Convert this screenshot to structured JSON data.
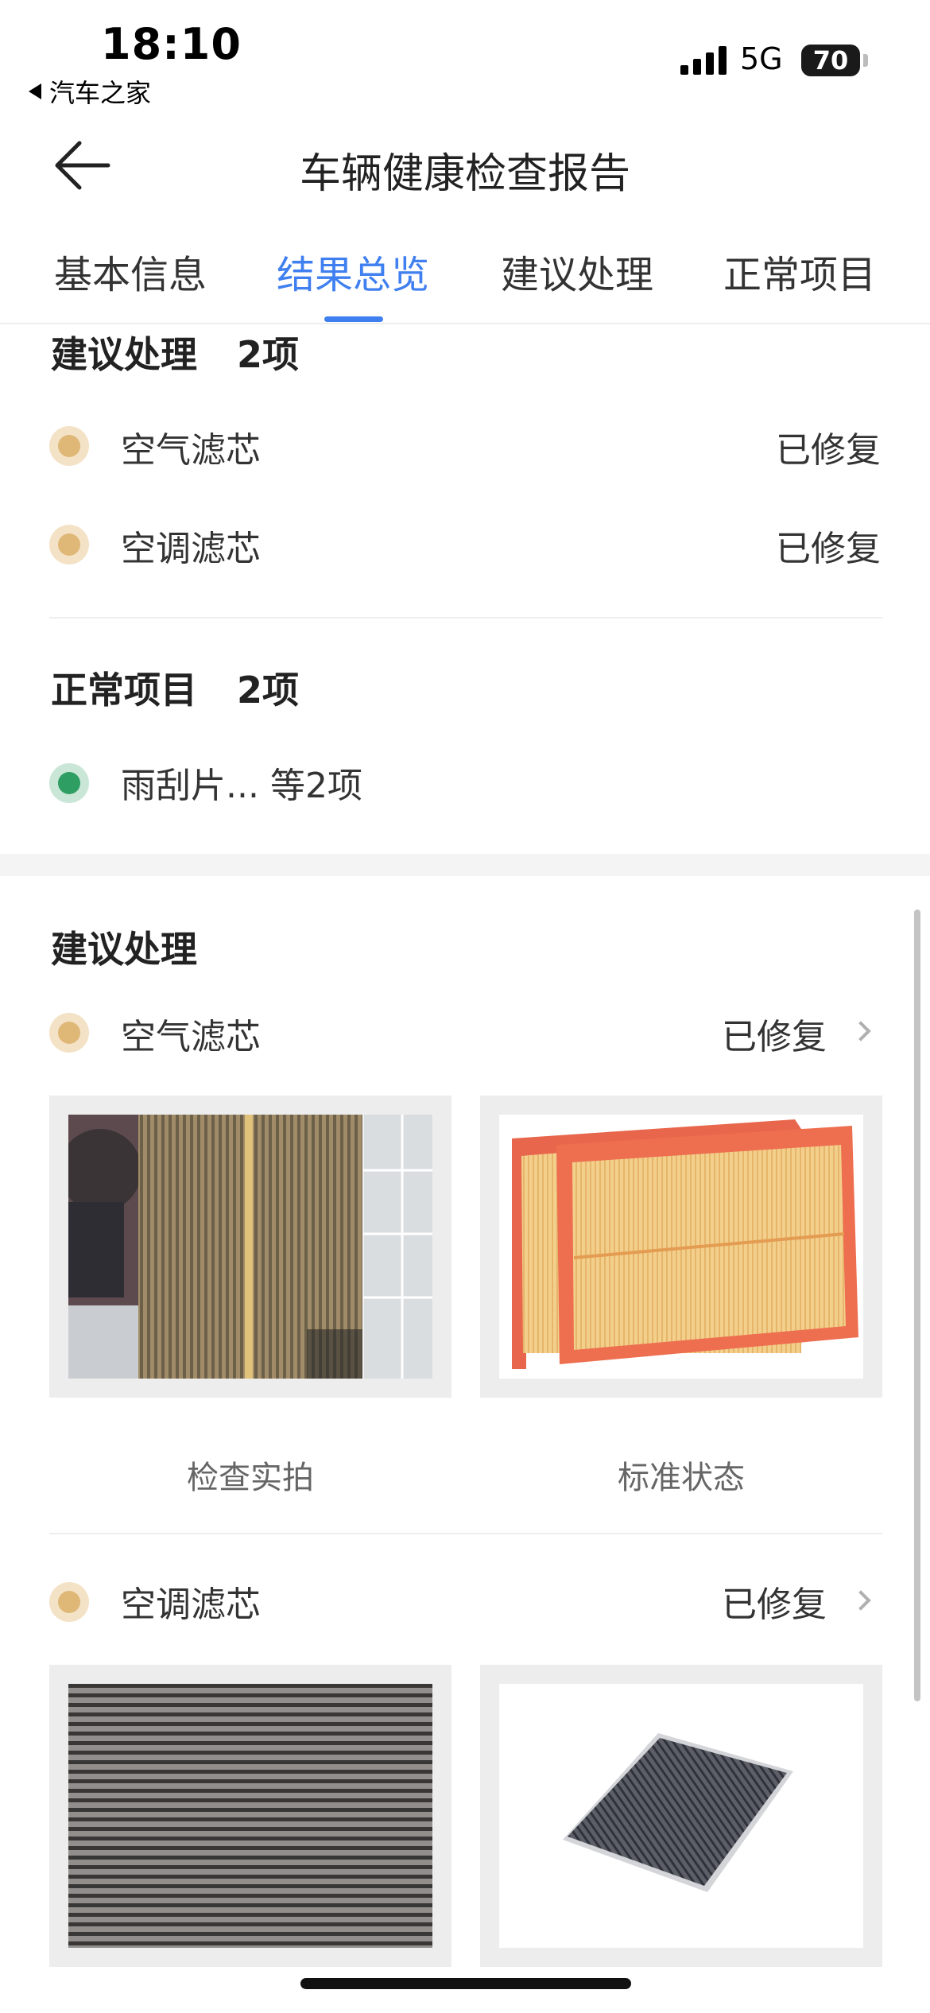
{
  "status_bar": {
    "time": "18:10",
    "back_app": "汽车之家",
    "network": "5G",
    "battery": "70"
  },
  "nav": {
    "back_icon": "arrow-left-icon",
    "title": "车辆健康检查报告"
  },
  "tabs": [
    {
      "label": "基本信息",
      "active": false
    },
    {
      "label": "结果总览",
      "active": true
    },
    {
      "label": "建议处理",
      "active": false
    },
    {
      "label": "正常项目",
      "active": false
    }
  ],
  "summary": {
    "suggest": {
      "title": "建议处理",
      "count": "2项",
      "items": [
        {
          "name": "空气滤芯",
          "status": "已修复"
        },
        {
          "name": "空调滤芯",
          "status": "已修复"
        }
      ]
    },
    "normal": {
      "title": "正常项目",
      "count": "2项",
      "items": [
        {
          "name": "雨刮片... 等2项"
        }
      ]
    }
  },
  "detail": {
    "title": "建议处理",
    "items": [
      {
        "name": "空气滤芯",
        "status": "已修复",
        "photo_captions": [
          "检查实拍",
          "标准状态"
        ]
      },
      {
        "name": "空调滤芯",
        "status": "已修复"
      }
    ]
  },
  "colors": {
    "accent": "#3f7ff0",
    "warn_dot": "#dfb878",
    "ok_dot": "#2f9e63"
  }
}
